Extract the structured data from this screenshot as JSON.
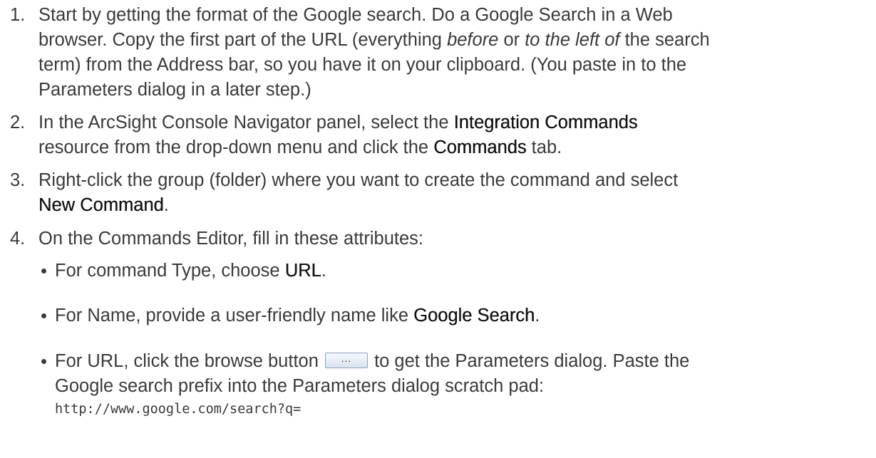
{
  "steps": [
    {
      "number": "1.",
      "lines": [
        {
          "a": "Start by getting the format of the Google search. Do a Google Search in a Web"
        },
        {
          "a": "browser. Copy the first part of the URL (everything ",
          "i1": "before",
          "b": " or ",
          "i2": "to the left of",
          "c": " the search"
        },
        {
          "a": "term) from the Address bar, so you have it on your clipboard. (You paste in to the"
        },
        {
          "a": "Parameters dialog in a later step.)"
        }
      ]
    },
    {
      "number": "2.",
      "line1_pre": "In the ArcSight Console Navigator panel, select the ",
      "line1_bold": "Integration Commands",
      "line2_pre": "resource from the drop-down menu and click the ",
      "line2_bold": "Commands",
      "line2_post": " tab."
    },
    {
      "number": "3.",
      "line1": "Right-click the group (folder) where you want to create the command and select",
      "line2_bold": "New Command",
      "line2_post": "."
    },
    {
      "number": "4.",
      "line1": "On the Commands Editor, fill in these attributes:"
    }
  ],
  "bullets": [
    {
      "pre": "For command Type, choose ",
      "bold": "URL",
      "post": "."
    },
    {
      "pre": "For Name, provide a user-friendly name like ",
      "bold": "Google Search",
      "post": "."
    },
    {
      "pre": "For URL, click the browse button ",
      "button_label": "...",
      "post": " to get the Parameters dialog. Paste the",
      "line2": "Google search prefix into the Parameters dialog scratch pad:",
      "code": "http://www.google.com/search?q="
    }
  ]
}
